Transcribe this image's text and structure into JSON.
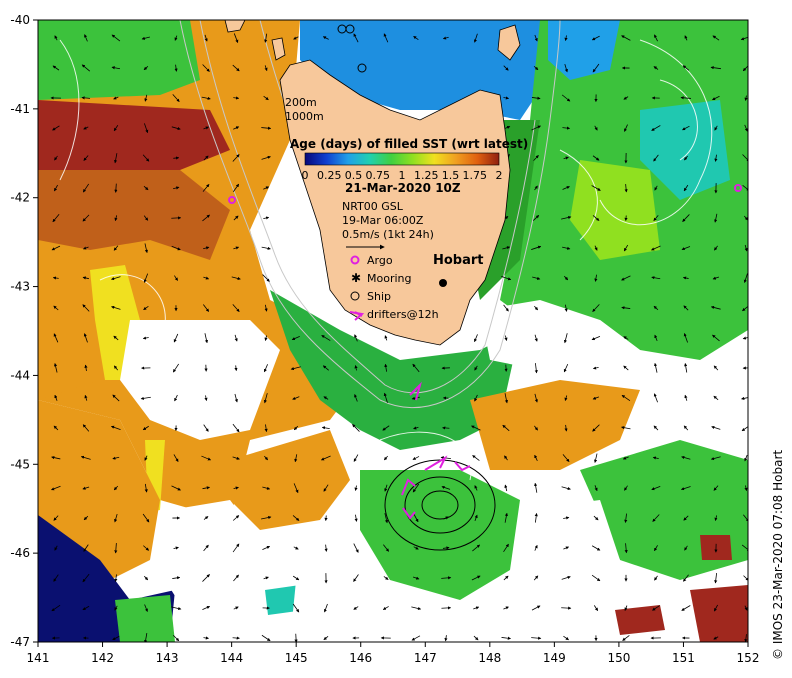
{
  "map": {
    "lon_range": [
      141,
      152
    ],
    "lat_range": [
      -47,
      -40
    ],
    "x_ticks": [
      "141",
      "142",
      "143",
      "144",
      "145",
      "146",
      "147",
      "148",
      "149",
      "150",
      "151",
      "152"
    ],
    "y_ticks": [
      "-40",
      "-41",
      "-42",
      "-43",
      "-44",
      "-45",
      "-46",
      "-47"
    ],
    "colors": {
      "land": "#f7c89b",
      "ocean_young": "#1e8fe0",
      "mid_green": "#3cc23c",
      "orange": "#e89a1a",
      "dark_orange": "#c0601a",
      "brown": "#a0281e",
      "yellow": "#f0e020",
      "navy": "#0a1070",
      "cloud": "#ffffff"
    }
  },
  "legend": {
    "contours": [
      "200m",
      "1000m"
    ],
    "colorbar_title": "Age (days) of filled SST (wrt latest)",
    "colorbar_ticks": [
      "0",
      "0.25",
      "0.5",
      "0.75",
      "1",
      "1.25",
      "1.5",
      "1.75",
      "2"
    ],
    "colorbar_stops": [
      "#08087a",
      "#1040d0",
      "#20a0e8",
      "#20d0b0",
      "#40d040",
      "#90e020",
      "#f0e020",
      "#f0a020",
      "#e06010",
      "#902010"
    ],
    "date": "21-Mar-2020 10Z",
    "current_source": "NRT00 GSL",
    "current_time": "19-Mar 06:00Z",
    "current_scale": "0.5m/s (1kt 24h)",
    "symbols": [
      {
        "label": "Argo",
        "icon": "argo-icon"
      },
      {
        "label": "Mooring",
        "icon": "mooring-icon"
      },
      {
        "label": "Ship",
        "icon": "ship-icon"
      },
      {
        "label": "drifters@12h",
        "icon": "drifter-icon"
      }
    ]
  },
  "places": {
    "hobart": "Hobart"
  },
  "credit": "© IMOS 23-Mar-2020 07:08 Hobart"
}
